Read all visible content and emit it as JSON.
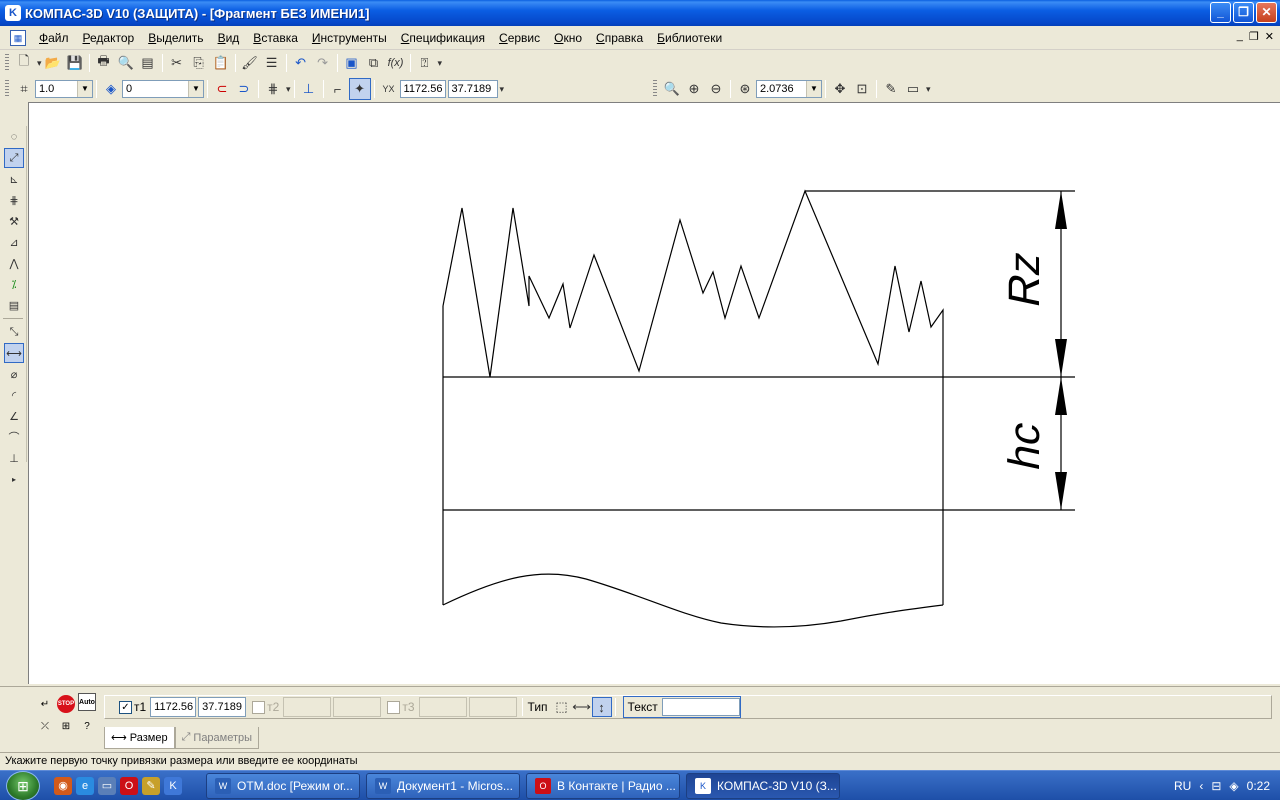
{
  "window": {
    "app_icon": "kompas-logo-icon",
    "title": "КОМПАС-3D V10 (ЗАЩИТА) - [Фрагмент БЕЗ ИМЕНИ1]",
    "minimize": "_",
    "maximize": "❐",
    "close": "✕"
  },
  "menu": {
    "items": [
      "Файл",
      "Редактор",
      "Выделить",
      "Вид",
      "Вставка",
      "Инструменты",
      "Спецификация",
      "Сервис",
      "Окно",
      "Справка",
      "Библиотеки"
    ],
    "mdi_minimize": "_",
    "mdi_restore": "❐",
    "mdi_close": "✕"
  },
  "toolbar": {
    "style_value": "1.0",
    "layer_value": "0",
    "coord_x": "1172.56",
    "coord_y": "37.7189",
    "zoom_value": "2.0736"
  },
  "drawing": {
    "label_rz": "Rz",
    "label_hc": "hc"
  },
  "properties": {
    "t1_label": "т1",
    "t1_x": "1172.56",
    "t1_y": "37.7189",
    "t2_label": "т2",
    "t3_label": "т3",
    "type_label": "Тип",
    "text_label": "Текст",
    "text_value": "",
    "auto_label": "Auto",
    "stop_label": "STOP",
    "tab_size": "Размер",
    "tab_params": "Параметры"
  },
  "status": {
    "message": "Укажите первую точку привязки размера или введите ее координаты"
  },
  "taskbar": {
    "tasks": [
      "OTM.doc [Режим ог...",
      "Документ1 - Micros...",
      "В Контакте | Радио ...",
      "КОМПАС-3D V10 (З..."
    ],
    "language": "RU",
    "time": "0:22"
  },
  "colors": {
    "titlebar": "#0b5ee3",
    "taskbar": "#1e4fa8",
    "pressed": "#c1d2ee"
  }
}
